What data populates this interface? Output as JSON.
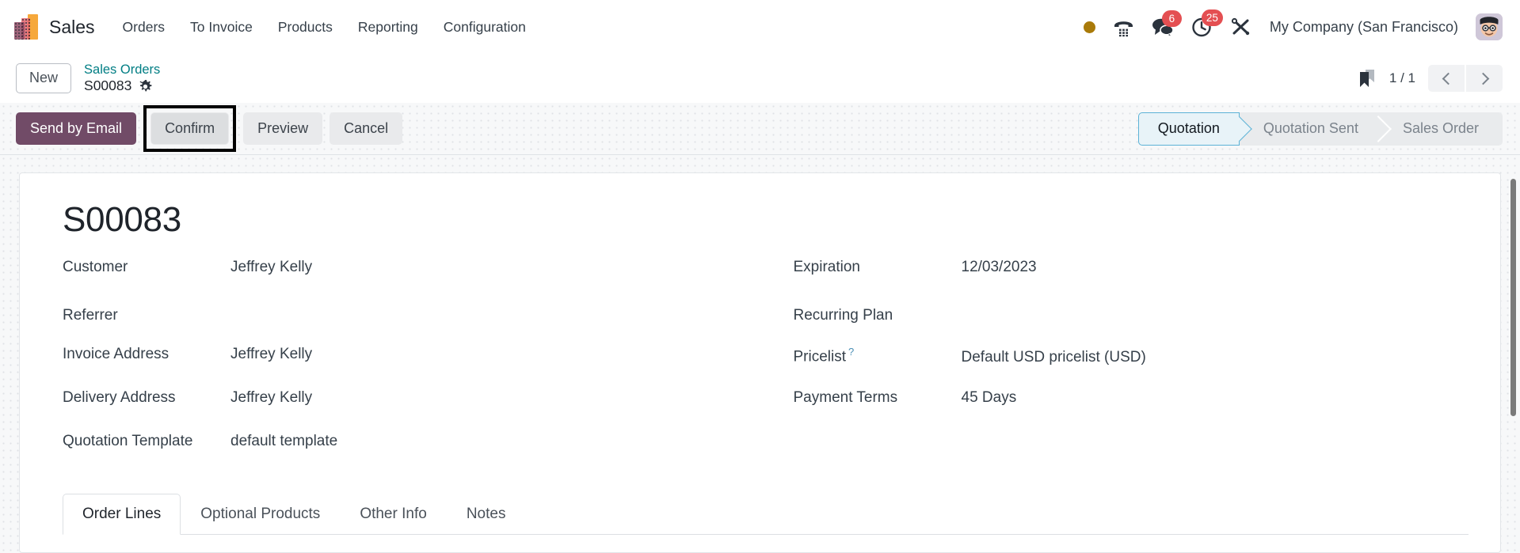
{
  "navbar": {
    "logo_icon": "sales-bar-chart-logo",
    "app_name": "Sales",
    "menu": [
      {
        "label": "Orders"
      },
      {
        "label": "To Invoice"
      },
      {
        "label": "Products"
      },
      {
        "label": "Reporting"
      },
      {
        "label": "Configuration"
      }
    ],
    "systray": {
      "presence_icon": "amber-status-dot",
      "phone_icon": "dialpad-phone-icon",
      "messages_icon": "chat-bubbles-icon",
      "messages_count": "6",
      "activities_icon": "clock-icon",
      "activities_count": "25",
      "debug_icon": "wrench-screwdriver-icon"
    },
    "company": "My Company (San Francisco)",
    "avatar_icon": "user-avatar"
  },
  "control_panel": {
    "new_label": "New",
    "breadcrumb_parent": "Sales Orders",
    "breadcrumb_current": "S00083",
    "settings_icon": "gear-icon",
    "bookmark_icon": "bookmark-flag-icon",
    "pager": "1 / 1",
    "prev_icon": "chevron-left-icon",
    "next_icon": "chevron-right-icon"
  },
  "actions": {
    "send_by_email": "Send by Email",
    "confirm": "Confirm",
    "preview": "Preview",
    "cancel": "Cancel",
    "focused_button": "Confirm"
  },
  "statusbar": {
    "steps": [
      {
        "label": "Quotation",
        "active": true
      },
      {
        "label": "Quotation Sent",
        "active": false
      },
      {
        "label": "Sales Order",
        "active": false
      }
    ],
    "active_color": "#e8f3f8",
    "active_border": "#5bb2d6"
  },
  "record": {
    "title": "S00083",
    "left_fields": [
      {
        "label": "Customer",
        "value": "Jeffrey Kelly"
      },
      {
        "label": "Referrer",
        "value": ""
      },
      {
        "label": "Invoice Address",
        "value": "Jeffrey Kelly"
      },
      {
        "label": "Delivery Address",
        "value": "Jeffrey Kelly"
      },
      {
        "label": "Quotation Template",
        "value": "default template"
      }
    ],
    "right_fields": [
      {
        "label": "Expiration",
        "value": "12/03/2023",
        "help": ""
      },
      {
        "label": "Recurring Plan",
        "value": "",
        "help": ""
      },
      {
        "label": "Pricelist",
        "value": "Default USD pricelist (USD)",
        "help": "?"
      },
      {
        "label": "Payment Terms",
        "value": "45 Days",
        "help": ""
      }
    ]
  },
  "tabs": [
    {
      "label": "Order Lines",
      "active": true
    },
    {
      "label": "Optional Products",
      "active": false
    },
    {
      "label": "Other Info",
      "active": false
    },
    {
      "label": "Notes",
      "active": false
    }
  ],
  "colors": {
    "brand_primary": "#714b67",
    "link_teal": "#017e84",
    "badge_red": "#e44f52",
    "status_amber": "#a97a09"
  }
}
